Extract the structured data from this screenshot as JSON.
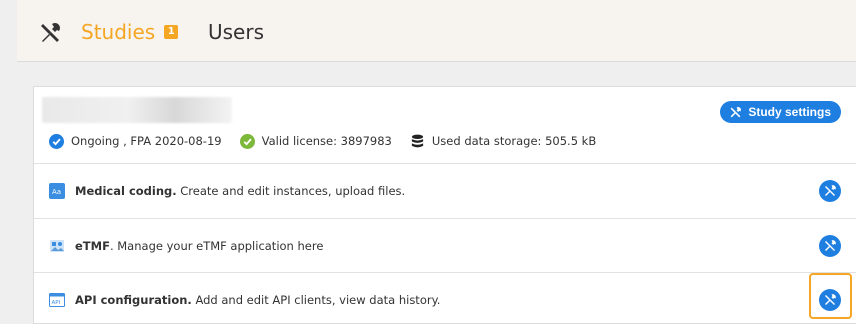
{
  "header": {
    "tabs": [
      {
        "label": "Studies",
        "badge": "1",
        "active": true
      },
      {
        "label": "Users",
        "active": false
      }
    ]
  },
  "study": {
    "settings_label": "Study settings",
    "status": {
      "phase": "Ongoing , FPA 2020-08-19",
      "license": "Valid license: 3897983",
      "storage": "Used data storage: 505.5 kB"
    }
  },
  "features": [
    {
      "title": "Medical coding.",
      "description": " Create and edit instances, upload files.",
      "icon": "medical-coding-icon"
    },
    {
      "title": "eTMF",
      "description": ". Manage your eTMF application here",
      "icon": "etmf-icon"
    },
    {
      "title": "API configuration.",
      "description": " Add and edit API clients, view data history.",
      "icon": "api-icon"
    }
  ],
  "colors": {
    "accent": "#f5a623",
    "primary": "#1e7fe0",
    "success": "#7cb83a"
  }
}
